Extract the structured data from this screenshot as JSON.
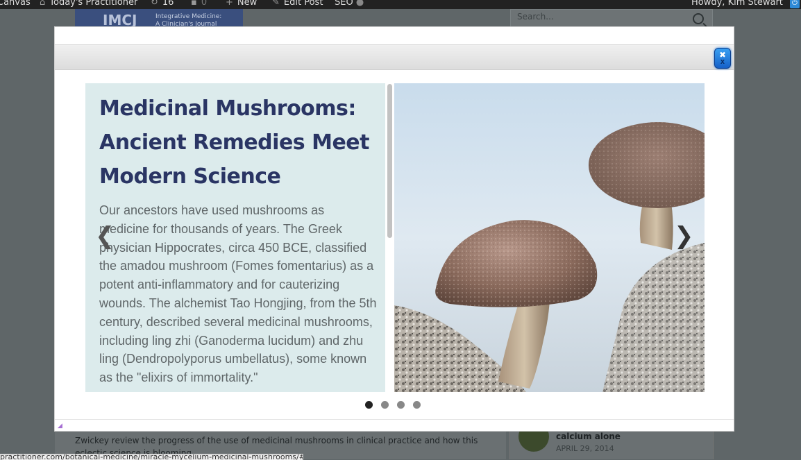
{
  "admin_bar": {
    "items": [
      {
        "label": "Canvas",
        "icon": "wordpress-icon"
      },
      {
        "label": "Today's Practitioner",
        "icon": "home-icon"
      },
      {
        "label": "16",
        "icon": "refresh-icon"
      },
      {
        "label": "0",
        "icon": "comment-icon"
      },
      {
        "label": "New",
        "icon": "plus-icon"
      },
      {
        "label": "Edit Post",
        "icon": "pencil-icon"
      },
      {
        "label": "SEO",
        "icon": "seo-status-icon"
      }
    ],
    "greeting": "Howdy, Kim Stewart"
  },
  "background": {
    "logo_mark": "IMCJ",
    "logo_sub_line1": "Integrative Medicine:",
    "logo_sub_line2": "A Clinician's Journal",
    "search_placeholder": "Search...",
    "article_line1": "Zwickey review the progress of the use of medicinal mushrooms in clinical practice and how this",
    "article_line2": "eclectic science is blooming.",
    "sidebar_title": "calcium alone",
    "sidebar_date": "APRIL 29, 2014",
    "status_url": "practitioner.com/botanical-medicine/miracle-mycelium-medicinal-mushrooms/#"
  },
  "modal": {
    "close_label": "✖",
    "close_sub": "X",
    "slide": {
      "title": "Medicinal Mushrooms: Ancient Remedies Meet Modern Science",
      "body": "Our ancestors have used mushrooms as medicine for thousands of years. The Greek physician Hippocrates, circa 450 BCE, classified the amadou mushroom (Fomes fomentarius) as a potent anti-inflammatory and for cauterizing wounds. The alchemist Tao Hongjing, from the 5th century, described several medicinal mushrooms, including ling zhi (Ganoderma lucidum) and zhu ling (Dendropolyporus umbellatus), some known as the \"elixirs of immortality.\"",
      "image_alt": "Shiitake mushrooms growing on a log"
    },
    "prev_label": "❮",
    "next_label": "❯",
    "pagination": {
      "count": 4,
      "active": 1
    }
  },
  "colors": {
    "title": "#2a3564",
    "text_panel_bg": "#dcebec",
    "close_button": "#1e78e0",
    "admin_bar": "#222222"
  }
}
